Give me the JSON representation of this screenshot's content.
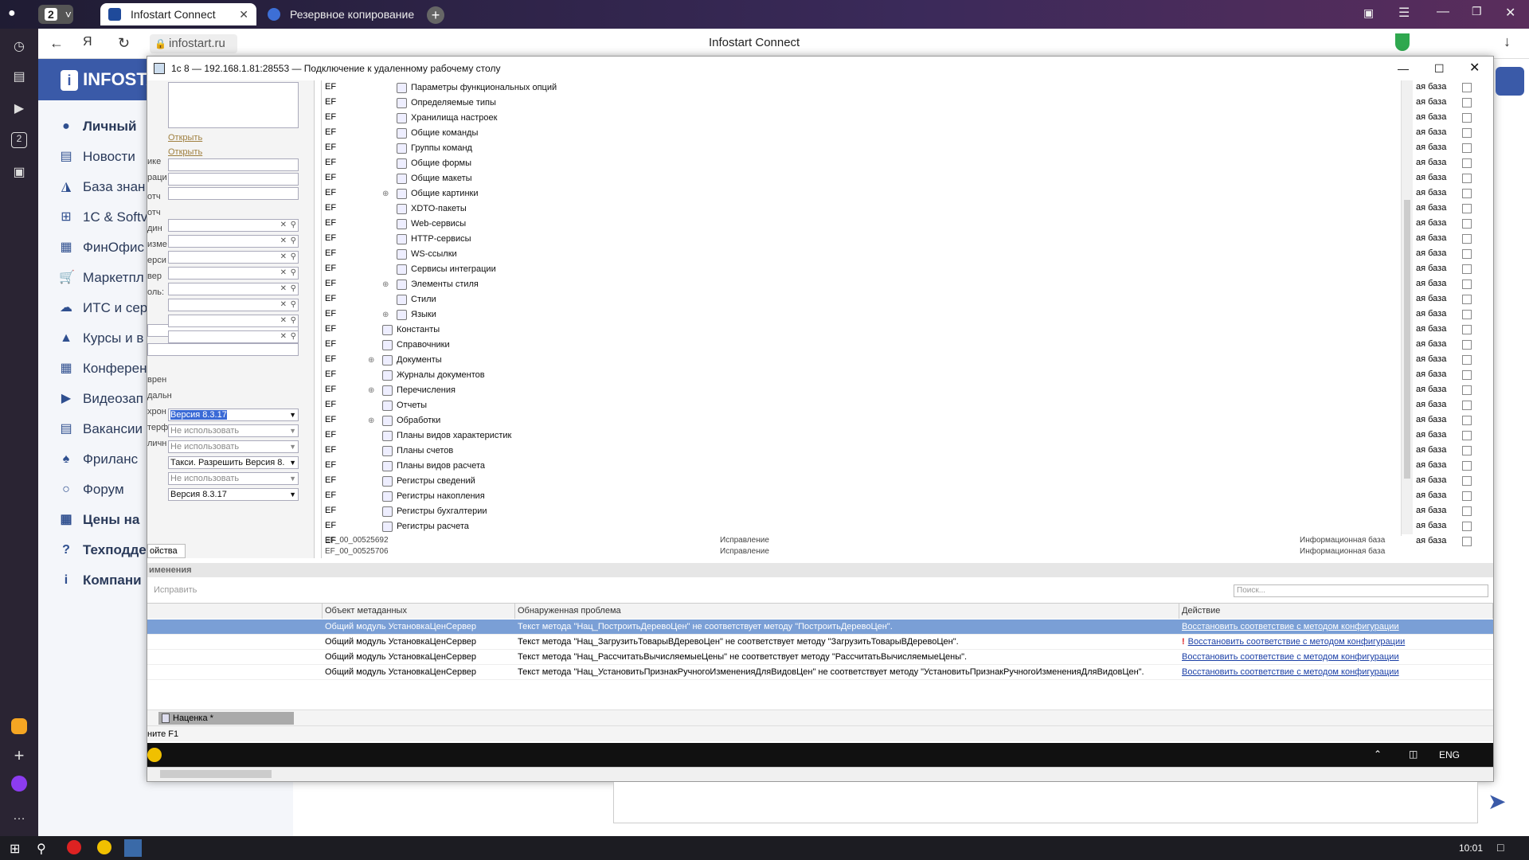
{
  "browser": {
    "tab_count": "2",
    "tabs": [
      {
        "label": "Infostart Connect",
        "active": true
      },
      {
        "label": "Резервное копирование",
        "active": false
      }
    ],
    "url": "infostart.ru",
    "page_title": "Infostart Connect"
  },
  "infostart": {
    "logo": "INFOSTA",
    "nav": [
      {
        "label": "Личный",
        "icon": "user-icon",
        "bold": true
      },
      {
        "label": "Новости",
        "icon": "news-icon"
      },
      {
        "label": "База знан",
        "icon": "database-icon"
      },
      {
        "label": "1С & Softv",
        "icon": "windows-icon"
      },
      {
        "label": "ФинОфис",
        "icon": "grid-icon"
      },
      {
        "label": "Маркетпл",
        "icon": "cart-icon"
      },
      {
        "label": "ИТС и сер",
        "icon": "cloud-icon"
      },
      {
        "label": "Курсы и в",
        "icon": "graduation-icon"
      },
      {
        "label": "Конферен",
        "icon": "calendar-icon"
      },
      {
        "label": "Видеозап",
        "icon": "video-icon"
      },
      {
        "label": "Вакансии",
        "icon": "card-icon"
      },
      {
        "label": "Фриланс",
        "icon": "handshake-icon"
      },
      {
        "label": "Форум",
        "icon": "chat-icon"
      },
      {
        "label": "Цены на",
        "icon": "table-icon",
        "bold": true
      },
      {
        "label": "Техподде",
        "icon": "help-icon",
        "bold": true
      },
      {
        "label": "Компани",
        "icon": "info-icon",
        "bold": true
      }
    ]
  },
  "rdp": {
    "title": "1с 8 — 192.168.1.81:28553 — Подключение к удаленному рабочему столу",
    "left_links": [
      "Открыть",
      "Открыть"
    ],
    "left_labels": [
      "ике",
      "раци",
      "отч",
      "отч",
      "дин",
      "изме",
      "ерси",
      "вер",
      "оль:",
      "врен",
      "дальн",
      "хрон",
      "терф",
      "личн"
    ],
    "selects": [
      {
        "value": "Версия 8.3.17",
        "highlight": true
      },
      {
        "value": "Не использовать"
      },
      {
        "value": "Не использовать"
      },
      {
        "value": "Такси. Разрешить Версия 8."
      },
      {
        "value": "Не использовать"
      },
      {
        "value": "Версия 8.3.17"
      }
    ],
    "props_tab": "ойства",
    "tree": [
      {
        "label": "Параметры функциональных опций",
        "indent": 1
      },
      {
        "label": "Определяемые типы",
        "indent": 1
      },
      {
        "label": "Хранилища настроек",
        "indent": 1
      },
      {
        "label": "Общие команды",
        "indent": 1
      },
      {
        "label": "Группы команд",
        "indent": 1
      },
      {
        "label": "Общие формы",
        "indent": 1
      },
      {
        "label": "Общие макеты",
        "indent": 1
      },
      {
        "label": "Общие картинки",
        "indent": 1,
        "expand": true
      },
      {
        "label": "XDTO-пакеты",
        "indent": 1
      },
      {
        "label": "Web-сервисы",
        "indent": 1
      },
      {
        "label": "HTTP-сервисы",
        "indent": 1
      },
      {
        "label": "WS-ссылки",
        "indent": 1
      },
      {
        "label": "Сервисы интеграции",
        "indent": 1
      },
      {
        "label": "Элементы стиля",
        "indent": 1,
        "expand": true
      },
      {
        "label": "Стили",
        "indent": 1
      },
      {
        "label": "Языки",
        "indent": 1,
        "expand": true
      },
      {
        "label": "Константы",
        "indent": 0
      },
      {
        "label": "Справочники",
        "indent": 0
      },
      {
        "label": "Документы",
        "indent": 0,
        "expand": true
      },
      {
        "label": "Журналы документов",
        "indent": 0
      },
      {
        "label": "Перечисления",
        "indent": 0,
        "expand": true
      },
      {
        "label": "Отчеты",
        "indent": 0
      },
      {
        "label": "Обработки",
        "indent": 0,
        "expand": true
      },
      {
        "label": "Планы видов характеристик",
        "indent": 0
      },
      {
        "label": "Планы счетов",
        "indent": 0
      },
      {
        "label": "Планы видов расчета",
        "indent": 0
      },
      {
        "label": "Регистры сведений",
        "indent": 0
      },
      {
        "label": "Регистры накопления",
        "indent": 0
      },
      {
        "label": "Регистры бухгалтерии",
        "indent": 0
      },
      {
        "label": "Регистры расчета",
        "indent": 0
      }
    ],
    "ef_prefix": "EF",
    "right_col_text": "ая база",
    "under_rows": [
      {
        "code": "EF_00_00525692",
        "type": "Исправление",
        "base": "Информационная база"
      },
      {
        "code": "EF_00_00525706",
        "type": "Исправление",
        "base": "Информационная база"
      }
    ],
    "section_title": "именения",
    "fix_button": "Исправить",
    "search_placeholder": "Поиск...",
    "issue_headers": [
      "Объект метаданных",
      "Обнаруженная проблема",
      "Действие"
    ],
    "issues": [
      {
        "object": "Общий модуль УстановкаЦенСервер",
        "problem": "Текст метода \"Нац_ПостроитьДеревоЦен\" не соответствует методу \"ПостроитьДеревоЦен\".",
        "action": "Восстановить соответствие с методом конфигурации",
        "selected": true
      },
      {
        "object": "Общий модуль УстановкаЦенСервер",
        "problem": "Текст метода \"Нац_ЗагрузитьТоварыВДеревоЦен\" не соответствует методу \"ЗагрузитьТоварыВДеревоЦен\".",
        "action": "Восстановить соответствие с методом конфигурации",
        "warn": true
      },
      {
        "object": "Общий модуль УстановкаЦенСервер",
        "problem": "Текст метода \"Нац_РассчитатьВычисляемыеЦены\" не соответствует методу \"РассчитатьВычисляемыеЦены\".",
        "action": "Восстановить соответствие с методом конфигурации"
      },
      {
        "object": "Общий модуль УстановкаЦенСервер",
        "problem": "Текст метода \"Нац_УстановитьПризнакРучногоИзмененияДляВидовЦен\" не соответствует методу \"УстановитьПризнакРучногоИзмененияДляВидовЦен\".",
        "action": "Восстановить соответствие с методом конфигурации"
      }
    ],
    "window_tab": "Наценка *",
    "status_hint": "ните F1",
    "tray_lang": "ENG"
  },
  "taskbar": {
    "time": "10:01"
  },
  "colors": {
    "accent": "#2f4f8f",
    "selection": "#7a9fd6",
    "link": "#1a3fa6"
  }
}
